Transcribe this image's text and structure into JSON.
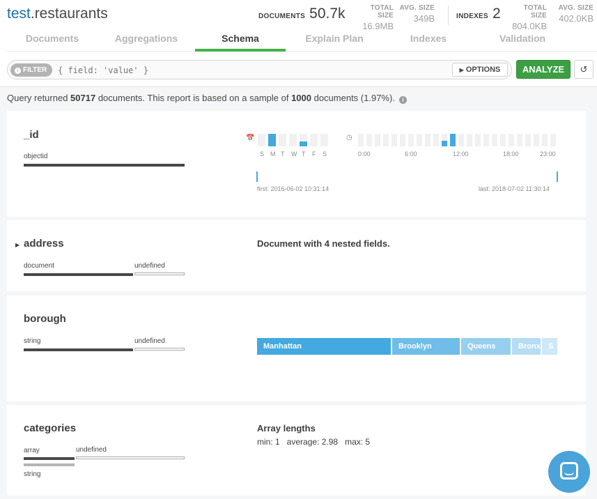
{
  "header": {
    "db": "test",
    "collection": ".restaurants",
    "documents": {
      "label": "DOCUMENTS",
      "value": "50.7k"
    },
    "doc_total_size": {
      "label": "TOTAL SIZE",
      "value": "16.9MB"
    },
    "doc_avg_size": {
      "label": "AVG. SIZE",
      "value": "349B"
    },
    "indexes": {
      "label": "INDEXES",
      "value": "2"
    },
    "idx_total_size": {
      "label": "TOTAL SIZE",
      "value": "804.0KB"
    },
    "idx_avg_size": {
      "label": "AVG. SIZE",
      "value": "402.0KB"
    }
  },
  "tabs": [
    {
      "label": "Documents"
    },
    {
      "label": "Aggregations"
    },
    {
      "label": "Schema",
      "active": true
    },
    {
      "label": "Explain Plan"
    },
    {
      "label": "Indexes"
    },
    {
      "label": "Validation"
    }
  ],
  "query": {
    "filter_label": "FILTER",
    "filter_placeholder": "{ field: 'value' }",
    "options_label": "OPTIONS",
    "analyze_label": "ANALYZE"
  },
  "status": {
    "prefix": "Query returned ",
    "count": "50717",
    "middle": " documents. This report is based on a sample of ",
    "sample": "1000",
    "suffix": " documents (1.97%)."
  },
  "fields": {
    "id": {
      "name": "_id",
      "types": [
        {
          "label": "objectid",
          "fraction": 1.0
        }
      ],
      "weekdays": {
        "labels": [
          "S",
          "M",
          "T",
          "W",
          "T",
          "F",
          "S"
        ],
        "active": [
          false,
          true,
          false,
          false,
          true,
          false,
          false
        ],
        "levels": [
          0,
          1.0,
          0,
          0,
          0.4,
          0,
          0
        ]
      },
      "hours": {
        "labels": [
          "0:00",
          "6:00",
          "12:00",
          "18:00",
          "23:00"
        ],
        "active_hours": [
          10,
          11
        ],
        "levels": {
          "10": 0.45,
          "11": 1.0
        }
      },
      "first": "first: 2016-06-02 10:31:14",
      "last": "last: 2018-07-02 11:30:14"
    },
    "address": {
      "name": "address",
      "types": [
        {
          "label": "document",
          "fraction": 0.68
        },
        {
          "label": "undefined",
          "fraction": 0.32
        }
      ],
      "description": "Document with 4 nested fields."
    },
    "borough": {
      "name": "borough",
      "types": [
        {
          "label": "string",
          "fraction": 0.68
        },
        {
          "label": "undefined",
          "fraction": 0.32
        }
      ],
      "values": [
        {
          "label": "Manhattan",
          "fraction": 0.45,
          "color": "#43a9e0"
        },
        {
          "label": "Brooklyn",
          "fraction": 0.23,
          "color": "#6fbde8"
        },
        {
          "label": "Queens",
          "fraction": 0.17,
          "color": "#97cfee"
        },
        {
          "label": "Bronx",
          "fraction": 0.1,
          "color": "#b5ddf3"
        },
        {
          "label": "S",
          "fraction": 0.05,
          "color": "#cde8f7"
        }
      ]
    },
    "categories": {
      "name": "categories",
      "types": [
        {
          "label": "array",
          "fraction": 0.32
        },
        {
          "label": "undefined",
          "fraction": 0.68
        }
      ],
      "subtype": "string",
      "array_title": "Array lengths",
      "array_stats": "min: 1   average: 2.98   max: 5"
    }
  }
}
